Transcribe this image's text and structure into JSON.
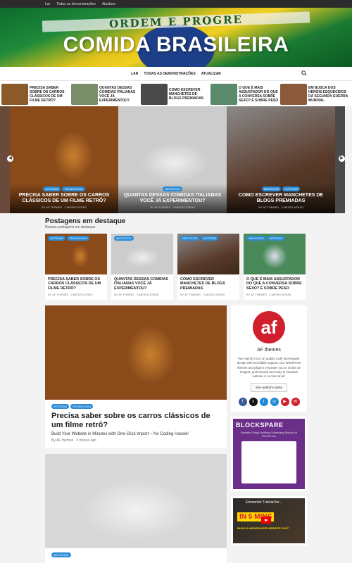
{
  "topbar": {
    "items": [
      "Lar",
      "Todas as demonstrações",
      "Atualizar"
    ]
  },
  "hero": {
    "title": "COMIDA BRASILEIRA",
    "flag_band": "ORDEM E PROGRE"
  },
  "nav": {
    "items": [
      "LAR",
      "TODAS AS DEMONSTRAÇÕES",
      "ATUALIZAR"
    ]
  },
  "ticker": [
    {
      "title": "PRECISA SABER SOBRE OS CARROS CLÁSSICOS DE UM FILME RETRÔ?",
      "color": "#8a5a2b"
    },
    {
      "title": "QUANTAS DESSAS COMIDAS ITALIANAS VOCÊ JÁ EXPERIMENTOU?",
      "color": "#7a8e6a"
    },
    {
      "title": "COMO ESCREVER MANCHETES DE BLOGS PREMIADAS",
      "color": "#4a4a4a"
    },
    {
      "title": "O QUE É MAIS ASSUSTADOR DO QUE A CONVERSA SOBRE SEXO? É SOBRE PESO",
      "color": "#5a8a6a"
    },
    {
      "title": "EM BUSCA DOS HERÓIS ESQUECIDOS DA SEGUNDA GUERRA MUNDIAL",
      "color": "#8a5a3a"
    }
  ],
  "slides": [
    {
      "tags": [
        "NOTÍCIAS",
        "TECNOLOGIA"
      ],
      "title": "PRECISA SABER SOBRE OS CARROS CLÁSSICOS DE UM FILME RETRÔ?",
      "author": "BY AF THEMES",
      "time": "3 MESES ATRÁS"
    },
    {
      "tags": [
        "NEGÓCIOS"
      ],
      "title": "QUANTAS DESSAS COMIDAS ITALIANAS VOCÊ JÁ EXPERIMENTOU?",
      "author": "BY AF THEMES",
      "time": "3 MESES ATRÁS"
    },
    {
      "tags": [
        "NEGÓCIOS",
        "NOTÍCIAS"
      ],
      "title": "COMO ESCREVER MANCHETES DE BLOGS PREMIADAS",
      "author": "BY AF THEMES",
      "time": "3 MESES ATRÁS"
    }
  ],
  "featured": {
    "title": "Postagens em destaque",
    "subtitle": "Nossas postagens em destaque",
    "cards": [
      {
        "tags": [
          "NOTÍCIAS",
          "TECNOLOGIA"
        ],
        "title": "PRECISA SABER SOBRE OS CARROS CLÁSSICOS DE UM FILME RETRÔ?",
        "author": "BY AF THEMES",
        "time": "3 MESES ATRÁS"
      },
      {
        "tags": [
          "NEGÓCIOS"
        ],
        "title": "QUANTAS DESSAS COMIDAS ITALIANAS VOCÊ JÁ EXPERIMENTOU?",
        "author": "BY AF THEMES",
        "time": "3 MESES ATRÁS"
      },
      {
        "tags": [
          "NEGÓCIOS",
          "NOTÍCIAS"
        ],
        "title": "COMO ESCREVER MANCHETES DE BLOGS PREMIADAS",
        "author": "BY AF THEMES",
        "time": "3 MESES ATRÁS"
      },
      {
        "tags": [
          "NEGÓCIOS",
          "NOTÍCIAS"
        ],
        "title": "O QUE É MAIS ASSUSTADOR DO QUE A CONVERSA SOBRE SEXO? É SOBRE PESO",
        "author": "BY AF THEMES",
        "time": "3 MESES ATRÁS"
      }
    ]
  },
  "posts": [
    {
      "tags": [
        "NOTÍCIAS",
        "TECNOLOGIA"
      ],
      "title": "Precisa saber sobre os carros clássicos de um filme retrô?",
      "desc": "Build Your Website in Minutes with One-Click Import – No Coding Hassle!",
      "author": "By AF themes",
      "time": "3 meses ago"
    },
    {
      "tags": [
        "NEGÓCIOS"
      ]
    }
  ],
  "author_widget": {
    "logo": "af",
    "name": "AF themes",
    "desc": "We mainly focus on quality code and elegant design with incredible support. Our WordPress themes and plugins empower you to create an elegant, professional and easy to maintain website in no time at all.",
    "button": "See author's posts",
    "social": [
      "f",
      "x",
      "t",
      "◎",
      "▶",
      "✉"
    ]
  },
  "blockspare": {
    "title": "BLOCKSPARE",
    "desc": "Beautiful Page Building Gutenberg Blocks for WordPress"
  },
  "video": {
    "title": "Elementor Tutorial for...",
    "badge": "IN 5 MINS",
    "sub": "BUILD A NEWSPAPER WEBSITE FAST"
  },
  "colors": {
    "accent": "#2a8bd6",
    "topbar": "#2b2b2b",
    "brand_red": "#d21f2e"
  }
}
